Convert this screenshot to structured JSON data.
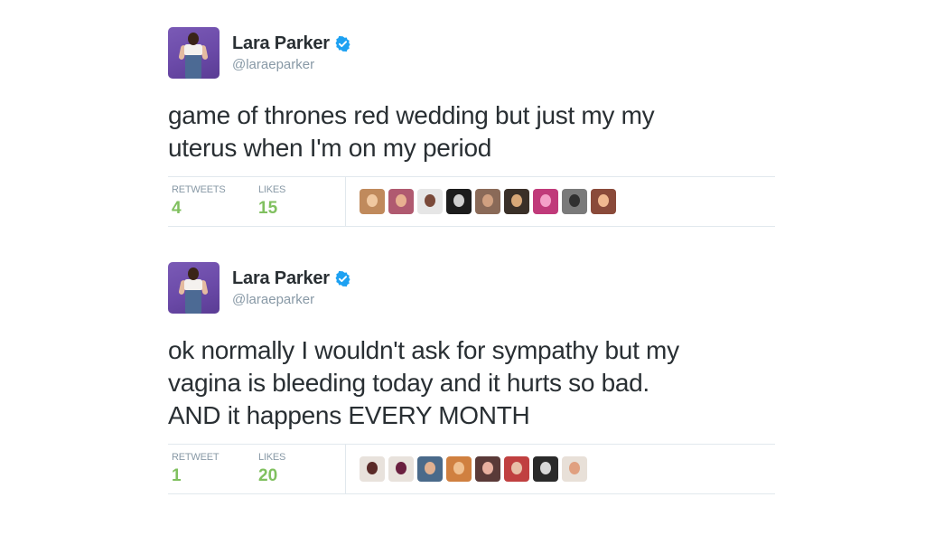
{
  "tweets": [
    {
      "author": {
        "name": "Lara Parker",
        "handle": "@laraeparker",
        "verified": true,
        "avatar_icon": "profile-photo-person-purple-bg"
      },
      "text_lines": [
        "game of thrones red wedding but just my my",
        "uterus when I'm on my period"
      ],
      "retweets": {
        "label": "RETWEETS",
        "value": "4"
      },
      "likes": {
        "label": "LIKES",
        "value": "15"
      },
      "liker_avatars": [
        {
          "bg": "#c08a5c",
          "face": "#f0c8a0"
        },
        {
          "bg": "#b05a70",
          "face": "#e8b090"
        },
        {
          "bg": "#e6e6e6",
          "face": "#7a4a3a"
        },
        {
          "bg": "#1c1c1c",
          "face": "#cfcfcf"
        },
        {
          "bg": "#8a6a58",
          "face": "#d0a080"
        },
        {
          "bg": "#3a3028",
          "face": "#d8a878"
        },
        {
          "bg": "#c03a7a",
          "face": "#f4a0c8"
        },
        {
          "bg": "#7a7a7a",
          "face": "#303030"
        },
        {
          "bg": "#8a4a3a",
          "face": "#f0b890"
        }
      ]
    },
    {
      "author": {
        "name": "Lara Parker",
        "handle": "@laraeparker",
        "verified": true,
        "avatar_icon": "profile-photo-person-purple-bg"
      },
      "text_lines": [
        "ok normally I wouldn't ask for sympathy but my",
        "vagina is bleeding today and it hurts so bad.",
        "AND it happens EVERY MONTH"
      ],
      "retweets": {
        "label": "RETWEET",
        "value": "1"
      },
      "likes": {
        "label": "LIKES",
        "value": "20"
      },
      "liker_avatars": [
        {
          "bg": "#e8e2dc",
          "face": "#5a2a28"
        },
        {
          "bg": "#e8e2dc",
          "face": "#6a2040"
        },
        {
          "bg": "#4a6a8a",
          "face": "#e0b090"
        },
        {
          "bg": "#d08040",
          "face": "#f0c090"
        },
        {
          "bg": "#5a3a38",
          "face": "#e8b0a0"
        },
        {
          "bg": "#c04040",
          "face": "#e8c0a8"
        },
        {
          "bg": "#2a2a2a",
          "face": "#d8d8d8"
        },
        {
          "bg": "#e8e0d8",
          "face": "#e0a080"
        }
      ]
    }
  ],
  "colors": {
    "text": "#292f33",
    "muted": "#8899a6",
    "count_green": "#80c05f",
    "verified_blue": "#1da1f2",
    "border": "#e1e8ed"
  }
}
